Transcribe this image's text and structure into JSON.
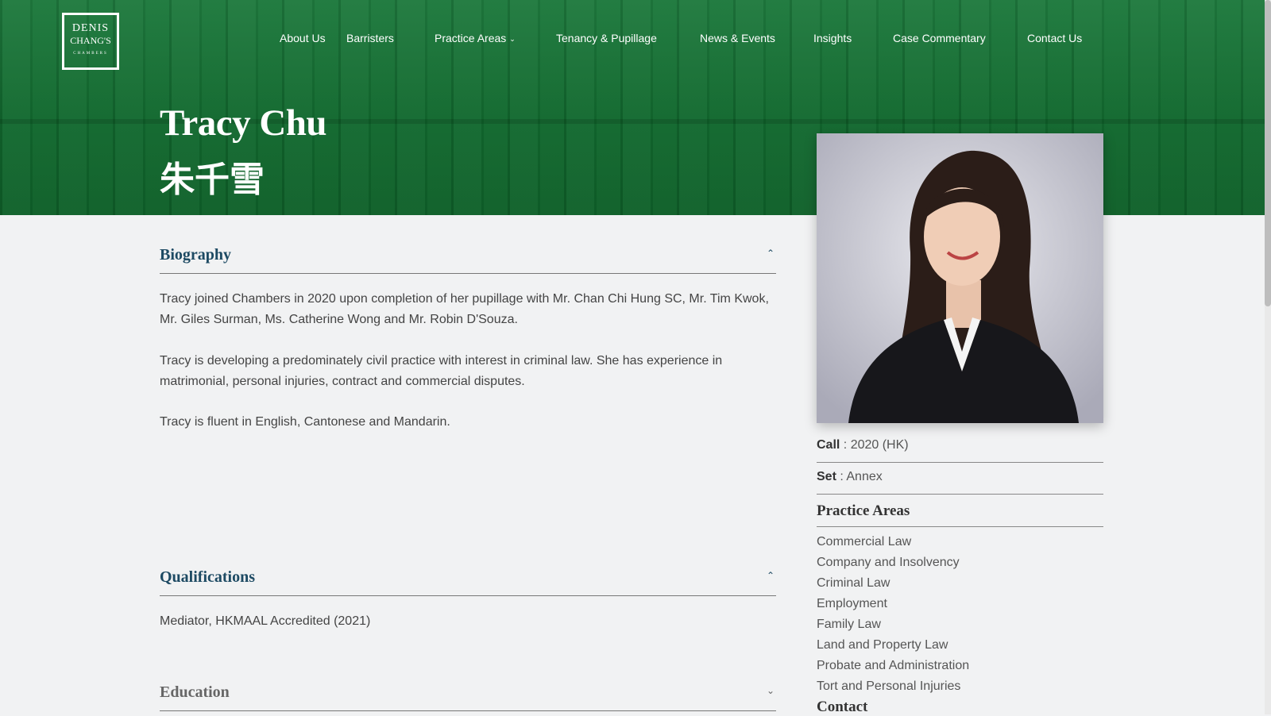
{
  "logo": {
    "line1": "DENIS",
    "line2": "CHANG'S",
    "line3": "CHAMBERS"
  },
  "nav": {
    "items": [
      "About Us",
      "Barristers",
      "Practice Areas",
      "Tenancy & Pupillage",
      "News & Events",
      "Insights",
      "Case Commentary",
      "Contact Us"
    ]
  },
  "profile": {
    "name_en": "Tracy Chu",
    "name_zh": "朱千雪"
  },
  "biography": {
    "title": "Biography",
    "paragraphs": [
      "Tracy joined Chambers in 2020 upon completion of her pupillage with Mr. Chan Chi Hung SC, Mr. Tim Kwok, Mr. Giles Surman, Ms. Catherine Wong and Mr. Robin D'Souza.",
      "Tracy is developing a predominately civil practice with interest in criminal law. She has experience in matrimonial, personal injuries, contract and commercial disputes.",
      "Tracy is fluent in English, Cantonese and Mandarin."
    ]
  },
  "qualifications": {
    "title": "Qualifications",
    "items": [
      "Mediator, HKMAAL Accredited (2021)"
    ]
  },
  "education": {
    "title": "Education"
  },
  "sidebar": {
    "call_label": "Call",
    "call_value": ": 2020 (HK)",
    "set_label": "Set",
    "set_value": ": Annex",
    "practice_title": "Practice Areas",
    "practice_areas": [
      "Commercial Law",
      "Company and Insolvency",
      "Criminal Law",
      "Employment",
      "Family Law",
      "Land and Property Law",
      "Probate and Administration",
      "Tort and Personal Injuries"
    ],
    "contact_title": "Contact"
  },
  "icons": {
    "collapse": "chevron-up-icon",
    "expand": "chevron-down-icon",
    "dropdown": "chevron-down-icon"
  },
  "colors": {
    "hero_green": "#17703a",
    "heading_blue": "#1d4a63",
    "background": "#f1f2f3"
  }
}
